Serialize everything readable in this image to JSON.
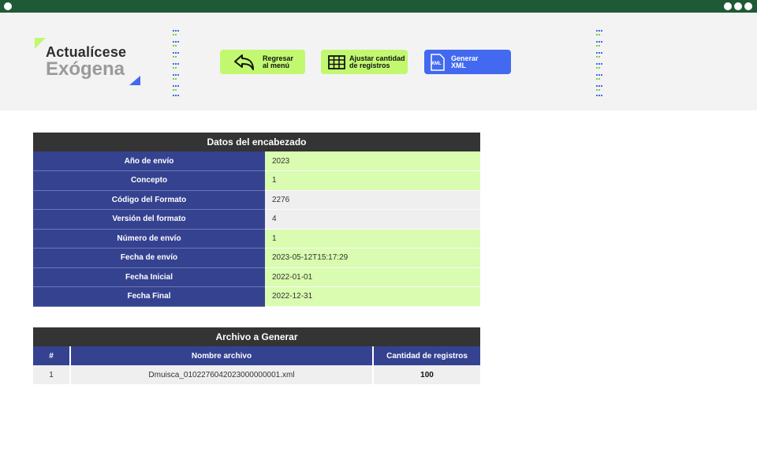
{
  "window": {
    "controls": [
      "circle",
      "circle",
      "circle",
      "circle"
    ]
  },
  "logo": {
    "line1": "Actualícese",
    "line2": "Exógena"
  },
  "toolbar": {
    "back_label": "Regresar\nal menú",
    "adjust_label": "Ajustar cantidad\nde registros",
    "xml_label": "Generar\nXML",
    "xml_icon_text": "XML"
  },
  "colors": {
    "header_bar": "#1e5a36",
    "accent_green": "#c2f870",
    "accent_blue": "#4269ef",
    "label_blue": "#354290",
    "value_green": "#d9fcb0"
  },
  "header_table": {
    "title": "Datos del encabezado",
    "rows": [
      {
        "label": "Año de envío",
        "value": "2023",
        "highlight": "green"
      },
      {
        "label": "Concepto",
        "value": "1",
        "highlight": "green"
      },
      {
        "label": "Código del Formato",
        "value": "2276",
        "highlight": "white"
      },
      {
        "label": "Versión del formato",
        "value": "4",
        "highlight": "white"
      },
      {
        "label": "Número de envío",
        "value": "1",
        "highlight": "green"
      },
      {
        "label": "Fecha de envío",
        "value": "2023-05-12T15:17:29",
        "highlight": "green"
      },
      {
        "label": "Fecha Inicial",
        "value": "2022-01-01",
        "highlight": "green"
      },
      {
        "label": "Fecha Final",
        "value": "2022-12-31",
        "highlight": "green"
      }
    ]
  },
  "file_table": {
    "title": "Archivo a Generar",
    "columns": [
      "#",
      "Nombre archivo",
      "Cantidad de registros"
    ],
    "rows": [
      {
        "index": "1",
        "name": "Dmuisca_0102276042023000000001.xml",
        "count": "100"
      }
    ]
  }
}
